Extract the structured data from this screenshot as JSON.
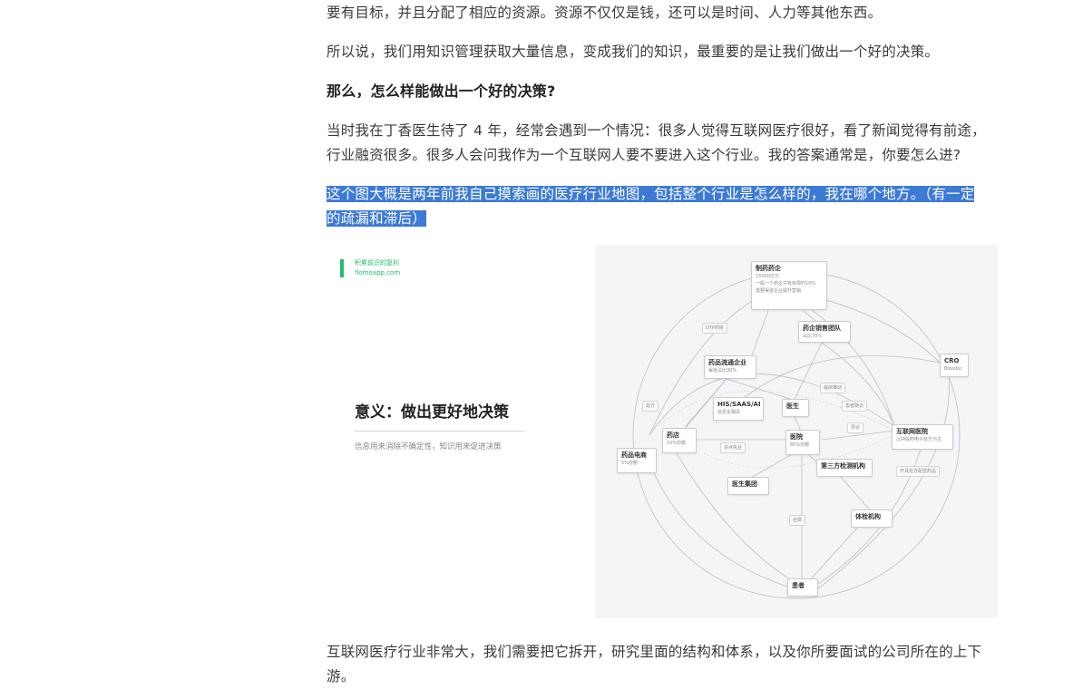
{
  "article": {
    "paragraphs": [
      "要有目标，并且分配了相应的资源。资源不仅仅是钱，还可以是时间、人力等其他东西。",
      "所以说，我们用知识管理获取大量信息，变成我们的知识，最重要的是让我们做出一个好的决策。",
      "那么，怎么样能做出一个好的决策?",
      "当时我在丁香医生待了 4 年，经常会遇到一个情况：很多人觉得互联网医疗很好，看了新闻觉得有前途，",
      "行业融资很多。很多人会问我作为一个互联网人要不要进入这个行业。我的答案通常是，你要怎么进?",
      "这个图大概是两年前我自己摸索画的医疗行业地图，包括整个行业是怎么样的，我在哪个地方。（有一定",
      "的疏漏和滞后）",
      "互联网医疗行业非常大，我们需要把它拆开，研究里面的结构和体系，以及你所要面试的公司所在的上下",
      "游。"
    ]
  },
  "slide": {
    "brand_name": "积累前识的复利",
    "brand_url": "flomoapp.com",
    "title": "意义：做出更好地决策",
    "subtitle": "信息用来消除不确定性，知识用来促进决策"
  },
  "map": {
    "nodes": {
      "pharma": {
        "title": "制药药企",
        "sub1": "15000亿元",
        "sub2": "一般一个药企只有有限约10%",
        "sub3": "需要渠道企业提升营销"
      },
      "sales_team": {
        "title": "药企销售团队",
        "sub": "占比70%"
      },
      "distributor": {
        "title": "药品流通企业",
        "sub": "渠道占比30%"
      },
      "cro": {
        "title": "CRO",
        "sub": "Bioodoc"
      },
      "his": {
        "title": "HIS/SAAS/AI",
        "sub": "信息化相关"
      },
      "doctor": {
        "title": "医生"
      },
      "pharmacy": {
        "title": "药店",
        "sub": "15%份额"
      },
      "hospital": {
        "title": "医院",
        "sub": "85%份额"
      },
      "internet_hospital": {
        "title": "互联网医院",
        "sub": "以冲段药电子处方为主"
      },
      "ecommerce": {
        "title": "药品电商",
        "sub": "5%份额"
      },
      "lab": {
        "title": "第三方检测机构"
      },
      "doctor_group": {
        "title": "医生集团"
      },
      "checkup": {
        "title": "体检机构"
      },
      "patient": {
        "title": "患者"
      }
    },
    "labels": {
      "dtp": "DTP药房",
      "promo": "临床推动",
      "rx": "处方",
      "followup": "患者随访",
      "guide": "导诊",
      "multi_site": "多点执业",
      "self_pay": "自费",
      "offline": "开具处方配送药品"
    }
  },
  "colors": {
    "highlight_bg": "#3d7ad6",
    "brand_green": "#1fbf6a",
    "map_bg": "#f4f5f6"
  }
}
